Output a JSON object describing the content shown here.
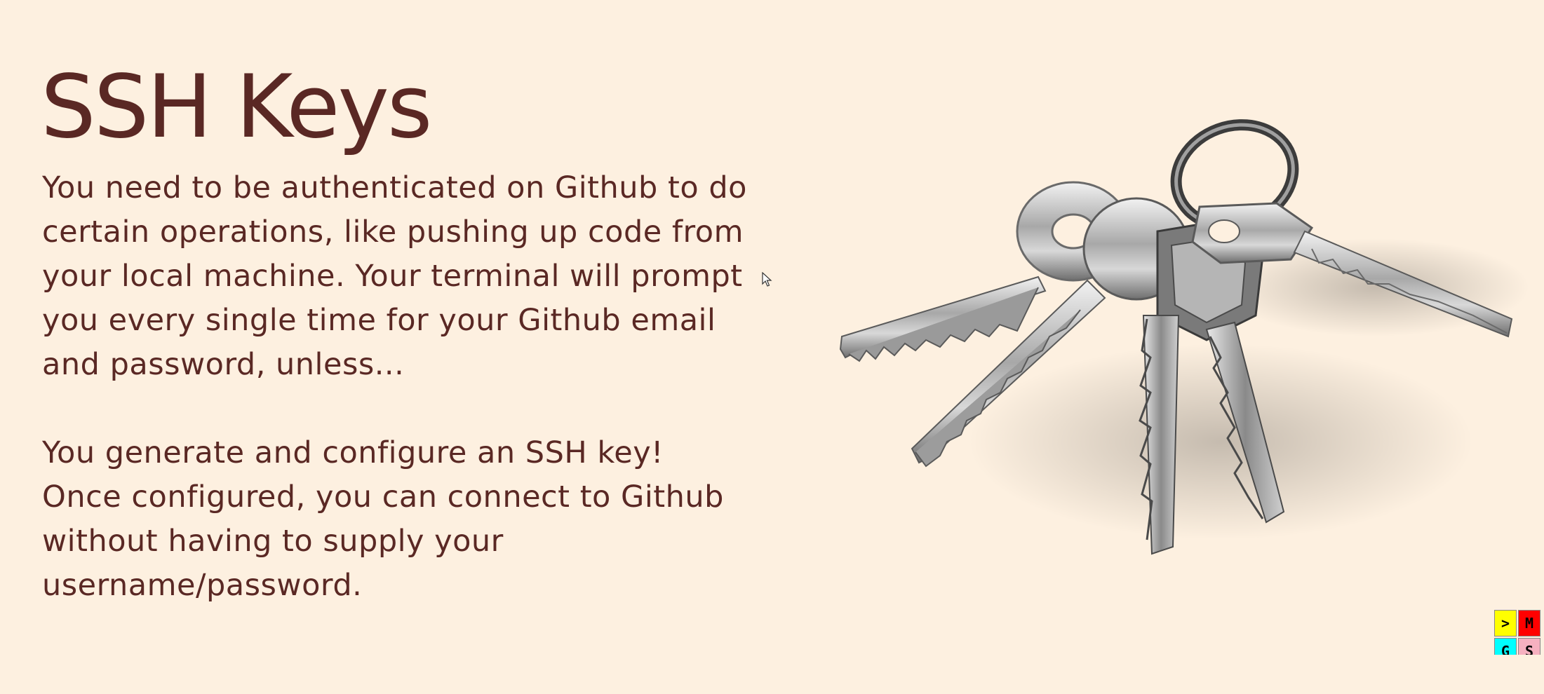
{
  "slide": {
    "title": "SSH Keys",
    "paragraph_1": "You need to be authenticated on Github to do certain operations, like pushing up code from your local machine.  Your terminal will prompt you every single time for your Github email and password, unless...",
    "paragraph_2": "You generate and configure an SSH key! Once configured, you can connect to Github without having to supply your username/password.",
    "image_icon": "keys-image"
  },
  "widget": {
    "cells": [
      ">",
      "M",
      "G",
      "S"
    ],
    "colors": [
      "#ffff00",
      "#ff0000",
      "#00ffff",
      "#f6b0c0"
    ]
  },
  "colors": {
    "background": "#fdf0e0",
    "text": "#5a2824"
  }
}
